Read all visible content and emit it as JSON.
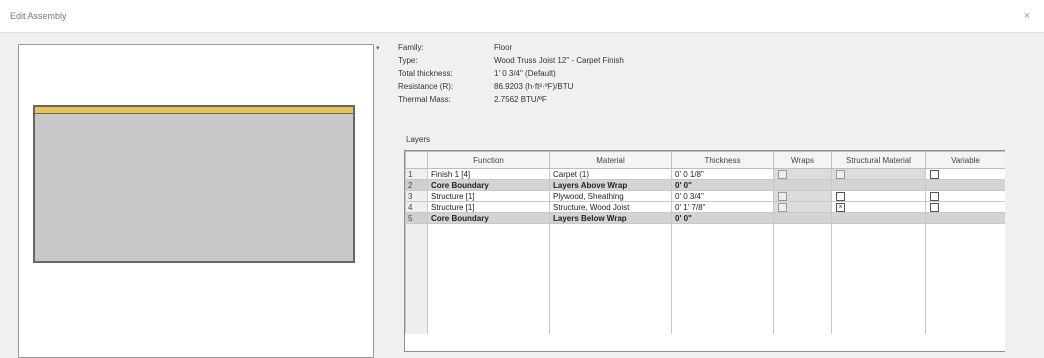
{
  "window": {
    "title": "Edit Assembly",
    "close_glyph": "×"
  },
  "collapse_glyph": "▾",
  "properties": [
    {
      "label": "Family:",
      "value": "Floor"
    },
    {
      "label": "Type:",
      "value": "Wood Truss Joist 12\" - Carpet Finish"
    },
    {
      "label": "Total thickness:",
      "value": "1' 0 3/4\" (Default)"
    },
    {
      "label": "Resistance (R):",
      "value": "86.9203 (h·ft²·ºF)/BTU"
    },
    {
      "label": "Thermal Mass:",
      "value": "2.7562 BTU/ºF"
    }
  ],
  "layers_caption": "Layers",
  "table": {
    "columns": [
      "",
      "Function",
      "Material",
      "Thickness",
      "Wraps",
      "Structural Material",
      "Variable"
    ],
    "rows": [
      {
        "num": "1",
        "function": "Finish 1 [4]",
        "material": "Carpet (1)",
        "thickness": "0' 0 1/8\"",
        "wraps": "",
        "structural": "",
        "variable": "",
        "boundary": false
      },
      {
        "num": "2",
        "function": "Core Boundary",
        "material": "Layers Above Wrap",
        "thickness": "0' 0\"",
        "wraps": "",
        "structural": "",
        "variable": "",
        "boundary": true
      },
      {
        "num": "3",
        "function": "Structure [1]",
        "material": "Plywood, Sheathing",
        "thickness": "0' 0 3/4\"",
        "wraps": "",
        "structural": "",
        "variable": "",
        "boundary": false
      },
      {
        "num": "4",
        "function": "Structure [1]",
        "material": "Structure, Wood Joist",
        "thickness": "0' 1' 7/8\"",
        "wraps": "",
        "structural": "×",
        "variable": "",
        "boundary": false
      },
      {
        "num": "5",
        "function": "Core Boundary",
        "material": "Layers Below Wrap",
        "thickness": "0' 0\"",
        "wraps": "",
        "structural": "",
        "variable": "",
        "boundary": true
      }
    ]
  }
}
